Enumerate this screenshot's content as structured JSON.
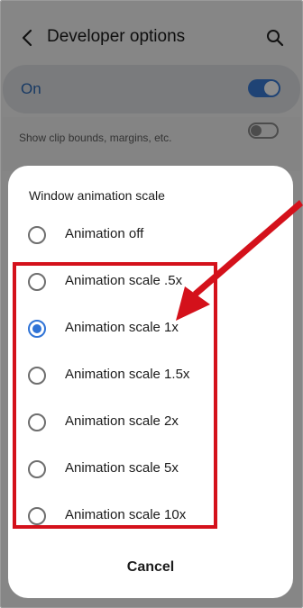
{
  "header": {
    "title": "Developer options"
  },
  "master_switch": {
    "label": "On",
    "state": "on",
    "accent": "#3a7bd5"
  },
  "background_row": {
    "subtitle": "Show clip bounds, margins, etc."
  },
  "dialog": {
    "title": "Window animation scale",
    "options": [
      {
        "label": "Animation off",
        "selected": false
      },
      {
        "label": "Animation scale .5x",
        "selected": false
      },
      {
        "label": "Animation scale 1x",
        "selected": true
      },
      {
        "label": "Animation scale 1.5x",
        "selected": false
      },
      {
        "label": "Animation scale 2x",
        "selected": false
      },
      {
        "label": "Animation scale 5x",
        "selected": false
      },
      {
        "label": "Animation scale 10x",
        "selected": false
      }
    ],
    "cancel_label": "Cancel",
    "accent": "#2f73d6"
  },
  "annotation": {
    "color": "#d4111b"
  }
}
